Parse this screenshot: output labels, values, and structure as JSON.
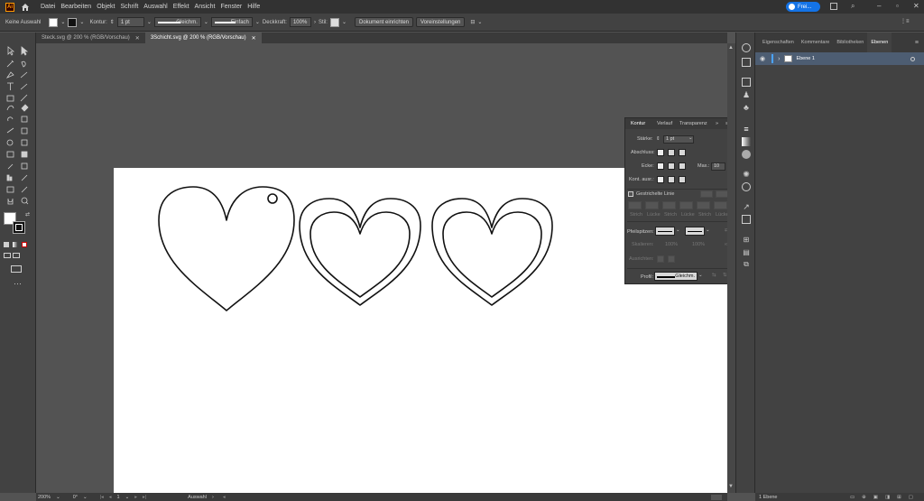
{
  "app": {
    "logo": "Ai"
  },
  "menu": [
    "Datei",
    "Bearbeiten",
    "Objekt",
    "Schrift",
    "Auswahl",
    "Effekt",
    "Ansicht",
    "Fenster",
    "Hilfe"
  ],
  "account": {
    "label": "Frei..."
  },
  "control": {
    "selection": "Keine Auswahl",
    "stroke_label": "Kontur:",
    "stroke_value": "1 pt",
    "profile1": "Gleichm.",
    "profile2": "Einfach",
    "opacity_label": "Deckkraft:",
    "opacity_value": "100%",
    "style_label": "Stil:",
    "doc_setup": "Dokument einrichten",
    "prefs": "Voreinstellungen"
  },
  "tabs": [
    {
      "label": "Steck.svg @ 200 % (RGB/Vorschau)",
      "active": false
    },
    {
      "label": "3Schicht.svg @ 200 % (RGB/Vorschau)",
      "active": true
    }
  ],
  "right_panel": {
    "tabs": [
      "Eigenschaften",
      "Kommentare",
      "Bibliotheken",
      "Ebenen"
    ],
    "layer_name": "Ebene 1",
    "layer_count": "1 Ebene"
  },
  "stroke_panel": {
    "tabs": [
      "Kontur",
      "Verlauf",
      "Transparenz"
    ],
    "weight_label": "Stärke:",
    "weight_value": "1 pt",
    "cap_label": "Abschluss:",
    "corner_label": "Ecke:",
    "limit_label": "Max.:",
    "limit_value": "10",
    "limit_unit": "x",
    "align_label": "Kont. ausr.:",
    "dashed_label": "Gestrichelte Linie",
    "dash_labels": [
      "Strich",
      "Lücke",
      "Strich",
      "Lücke",
      "Strich",
      "Lücke"
    ],
    "arrow_label": "Pfeilspitzen:",
    "scale_label": "Skalieren:",
    "scale1": "100%",
    "scale2": "100%",
    "align2_label": "Ausrichten:",
    "profile_label": "Profil:",
    "profile_value": "Gleichm."
  },
  "status": {
    "zoom": "200%",
    "rotation": "0°",
    "artboard": "1",
    "mode": "Auswahl"
  }
}
